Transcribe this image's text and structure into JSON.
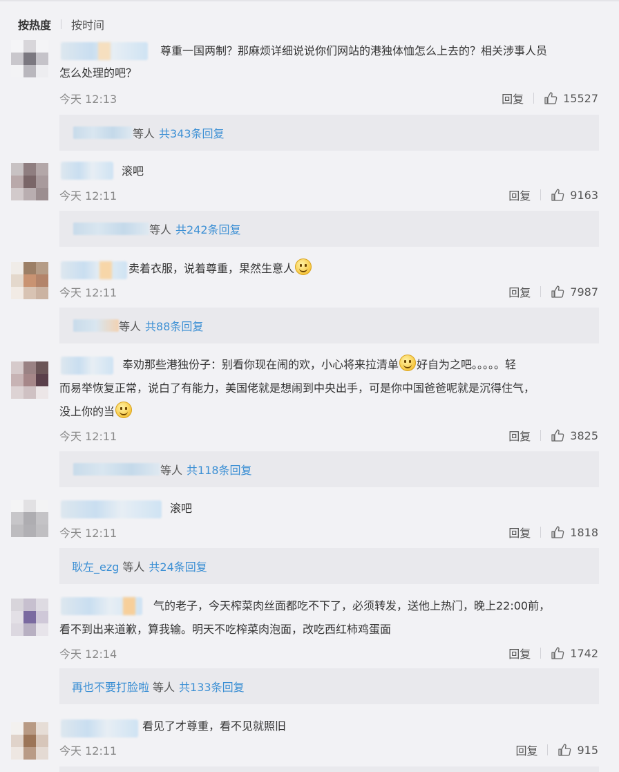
{
  "sort": {
    "hot": "按热度",
    "time": "按时间"
  },
  "labels": {
    "reply": "回复",
    "etc": "等人"
  },
  "comments": [
    {
      "text_line1": "尊重一国两制？那麻烦详细说说你们网站的港独体恤怎么上去的？相关涉事人员",
      "text_line2": "怎么处理的吧？",
      "time": "今天 12:13",
      "likes": "15527",
      "reply_named": "",
      "reply_count": "共343条回复"
    },
    {
      "text_line1": "滚吧",
      "time": "今天 12:11",
      "likes": "9163",
      "reply_named": "",
      "reply_count": "共242条回复"
    },
    {
      "text_line1": "卖着衣服，说着尊重，果然生意人",
      "time": "今天 12:11",
      "likes": "7987",
      "reply_named": "",
      "reply_count": "共88条回复"
    },
    {
      "text_line1a": "奉劝那些港独份子：别看你现在闹的欢，小心将来拉清单",
      "text_line1b": "好自为之吧。。。。。轻",
      "text_line2": "而易举恢复正常，说白了有能力，美国佬就是想闹到中央出手，可是你中国爸爸呢就是沉得住气，",
      "text_line3": "没上你的当",
      "time": "今天 12:11",
      "likes": "3825",
      "reply_named": "",
      "reply_count": "共118条回复"
    },
    {
      "text_line1": "滚吧",
      "time": "今天 12:11",
      "likes": "1818",
      "reply_named": "耿左_ezg",
      "reply_count": "共24条回复"
    },
    {
      "text_line1": "气的老子，今天榨菜肉丝面都吃不下了，必须转发，送他上热门，晚上22:00前，",
      "text_line2": "看不到出来道歉，算我输。明天不吃榨菜肉泡面，改吃西红柿鸡蛋面",
      "time": "今天 12:14",
      "likes": "1742",
      "reply_named": "再也不要打脸啦",
      "reply_count": "共133条回复"
    },
    {
      "text_line1": "看见了才尊重，看不见就照旧",
      "time": "今天 12:11",
      "likes": "915"
    }
  ],
  "colors": {
    "link": "#3b8fd4",
    "background": "#f2f2f5",
    "reply_box": "#e9e9ed"
  },
  "icons": {
    "like": "thumbs-up-icon",
    "emoji": "smile-emoji-icon"
  }
}
